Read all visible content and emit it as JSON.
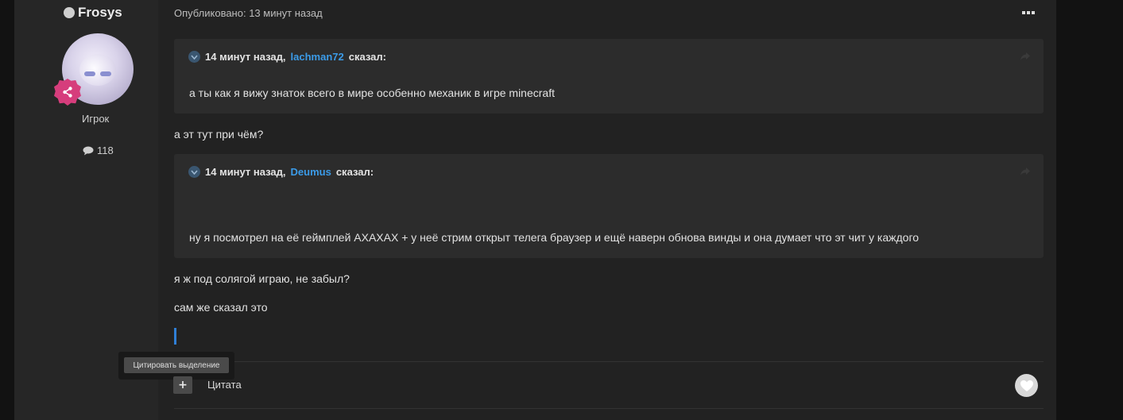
{
  "author": {
    "name": "Frosys",
    "role": "Игрок",
    "post_count": "118"
  },
  "post": {
    "published": "Опубликовано: 13 минут назад",
    "quotes": [
      {
        "time": "14 минут назад,",
        "user": "lachman72",
        "said": "сказал:",
        "text": "а ты как я вижу знаток всего в мире особенно механик в игре minecraft"
      },
      {
        "time": "14 минут назад,",
        "user": "Deumus",
        "said": "сказал:",
        "text": "ну я посмотрел на её геймплей АХАХАХ + у неё стрим открыт телега браузер и ещё наверн обнова винды и она думает что эт чит у каждого"
      }
    ],
    "reply_1": "а эт тут при чём?",
    "reply_2": "я ж под солягой играю, не забыл?",
    "reply_3": "сам же сказал это"
  },
  "tooltip": "Цитировать выделение",
  "actions": {
    "plus": "+",
    "quote_label": "Цитата"
  },
  "colors": {
    "link": "#3b9be8",
    "badge": "#d63d7c",
    "caret": "#2f7fd6"
  },
  "icons": [
    "status-dot-icon",
    "rank-badge-icon",
    "comment-icon",
    "more-icon",
    "quote-icon",
    "share-icon",
    "heart-icon"
  ]
}
